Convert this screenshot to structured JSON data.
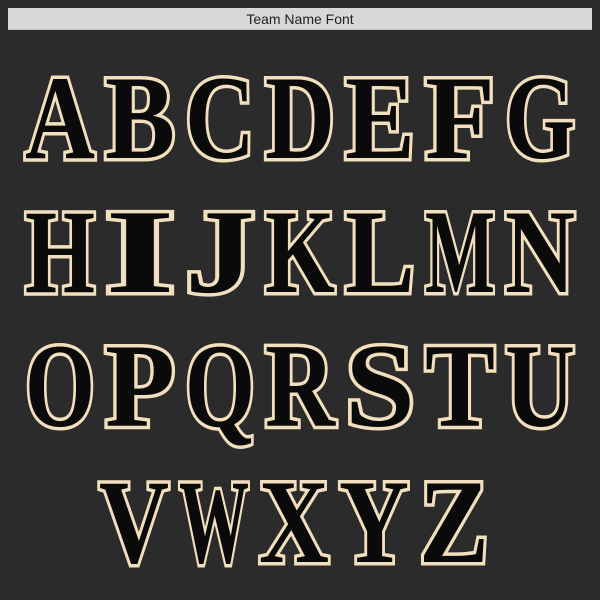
{
  "title": "Team Name Font",
  "colors": {
    "background": "#2b2b2b",
    "title_bar": "#d8d8d8",
    "title_text": "#222222",
    "letter_fill": "#0a0a0a",
    "letter_outline": "#f2dfbd"
  },
  "rows": [
    [
      "A",
      "B",
      "C",
      "D",
      "E",
      "F",
      "G"
    ],
    [
      "H",
      "I",
      "J",
      "K",
      "L",
      "M",
      "N"
    ],
    [
      "O",
      "P",
      "Q",
      "R",
      "S",
      "T",
      "U"
    ],
    [
      "V",
      "W",
      "X",
      "Y",
      "Z"
    ]
  ]
}
